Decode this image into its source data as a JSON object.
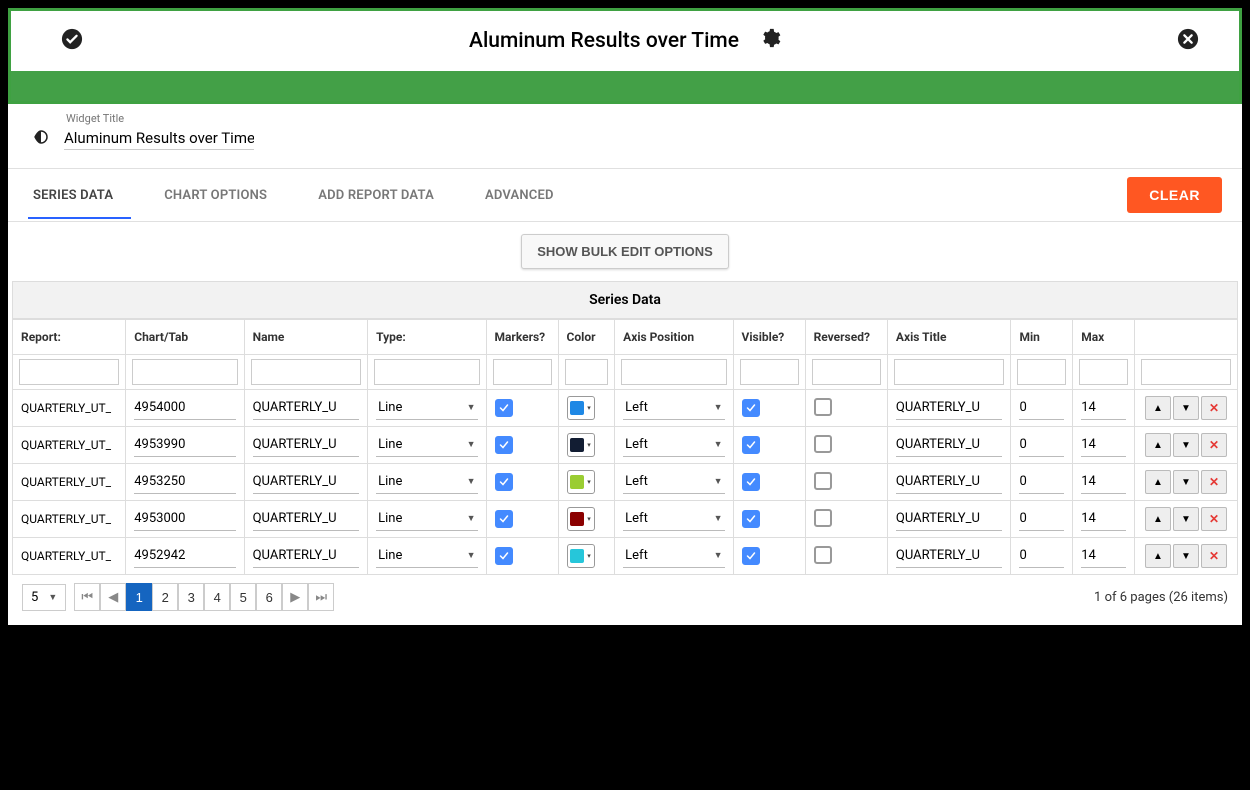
{
  "header": {
    "title": "Aluminum Results over Time"
  },
  "widget_title": {
    "label": "Widget Title",
    "value": "Aluminum Results over Time"
  },
  "tabs": [
    {
      "label": "SERIES DATA",
      "active": true
    },
    {
      "label": "CHART OPTIONS",
      "active": false
    },
    {
      "label": "ADD REPORT DATA",
      "active": false
    },
    {
      "label": "ADVANCED",
      "active": false
    }
  ],
  "buttons": {
    "clear": "CLEAR",
    "bulk": "SHOW BULK EDIT OPTIONS"
  },
  "grid": {
    "title": "Series Data",
    "columns": [
      "Report:",
      "Chart/Tab",
      "Name",
      "Type:",
      "Markers?",
      "Color",
      "Axis Position",
      "Visible?",
      "Reversed?",
      "Axis Title",
      "Min",
      "Max",
      ""
    ],
    "rows": [
      {
        "report": "QUARTERLY_UT_",
        "chart": "4954000",
        "name": "QUARTERLY_U",
        "type": "Line",
        "markers": true,
        "color": "#1e88e5",
        "axis": "Left",
        "visible": true,
        "reversed": false,
        "axis_title": "QUARTERLY_U",
        "min": "0",
        "max": "14"
      },
      {
        "report": "QUARTERLY_UT_",
        "chart": "4953990",
        "name": "QUARTERLY_U",
        "type": "Line",
        "markers": true,
        "color": "#121d33",
        "axis": "Left",
        "visible": true,
        "reversed": false,
        "axis_title": "QUARTERLY_U",
        "min": "0",
        "max": "14"
      },
      {
        "report": "QUARTERLY_UT_",
        "chart": "4953250",
        "name": "QUARTERLY_U",
        "type": "Line",
        "markers": true,
        "color": "#9acd32",
        "axis": "Left",
        "visible": true,
        "reversed": false,
        "axis_title": "QUARTERLY_U",
        "min": "0",
        "max": "14"
      },
      {
        "report": "QUARTERLY_UT_",
        "chart": "4953000",
        "name": "QUARTERLY_U",
        "type": "Line",
        "markers": true,
        "color": "#8b0000",
        "axis": "Left",
        "visible": true,
        "reversed": false,
        "axis_title": "QUARTERLY_U",
        "min": "0",
        "max": "14"
      },
      {
        "report": "QUARTERLY_UT_",
        "chart": "4952942",
        "name": "QUARTERLY_U",
        "type": "Line",
        "markers": true,
        "color": "#26c6da",
        "axis": "Left",
        "visible": true,
        "reversed": false,
        "axis_title": "QUARTERLY_U",
        "min": "0",
        "max": "14"
      }
    ]
  },
  "pager": {
    "page_size": "5",
    "pages": [
      "1",
      "2",
      "3",
      "4",
      "5",
      "6"
    ],
    "active_page": "1",
    "info": "1 of 6 pages (26 items)"
  }
}
